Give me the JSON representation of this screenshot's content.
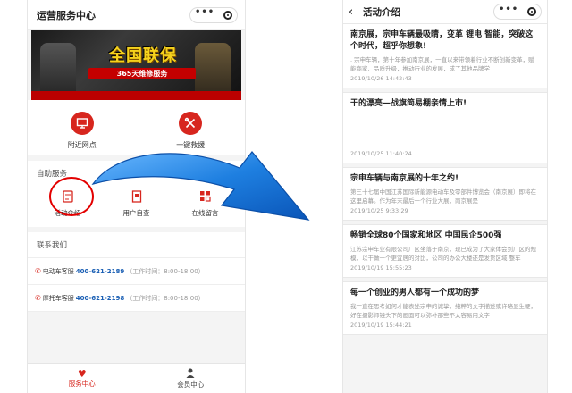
{
  "left_phone": {
    "title": "运营服务中心",
    "capsule": {
      "dots": "•••",
      "close_icon": "target-circle-icon"
    },
    "banner": {
      "main_text": "全国联保",
      "sub_text": "365天维修服务"
    },
    "quick_links": [
      {
        "label": "附近网点",
        "icon": "monitor-icon"
      },
      {
        "label": "一键救援",
        "icon": "tools-icon"
      }
    ],
    "self_service_title": "自助服务",
    "self_services": [
      {
        "label": "活动介绍",
        "icon": "document-icon"
      },
      {
        "label": "用户自查",
        "icon": "file-icon"
      },
      {
        "label": "在线留言",
        "icon": "grid-icon"
      }
    ],
    "contact_title": "联系我们",
    "contacts": [
      {
        "label": "电动车客服",
        "number": "400-621-2189",
        "hours": "（工作时间：8:00-18:00）"
      },
      {
        "label": "摩托车客服",
        "number": "400-621-2198",
        "hours": "（工作时间：8:00-18:00）"
      }
    ],
    "tabs": [
      {
        "label": "服务中心",
        "icon": "heart-icon",
        "active": true
      },
      {
        "label": "会员中心",
        "icon": "person-icon",
        "active": false
      }
    ]
  },
  "right_phone": {
    "title": "活动介绍",
    "back_icon": "chevron-left-icon",
    "articles": [
      {
        "title": "南京展，宗申车辆最吸睛，变革 锂电 智能，突破这个时代，超乎你想象!",
        "body": ". 宗申车辆，第十年参加南京展，一直以来带领着行业不断创新变革，赋能商家、品质升级，推动行业的发展，成了其他品牌学",
        "date": "2019/10/26 14:42:43"
      },
      {
        "title": "干的漂亮—战旗简易棚亲情上市!",
        "body": "",
        "date": "2019/10/25 11:40:24"
      },
      {
        "title": "宗申车辆与南京展的十年之约!",
        "body": "第三十七届中国江苏国际新能源电动车及零部件博览会（南京展）即将在这里启幕。作为年末最后一个行业大展，南京展是",
        "date": "2019/10/25 9:33:29"
      },
      {
        "title": "畅销全球80个国家和地区 中国民企500强",
        "body": "江苏宗申车业有限公司厂区坐落于南京，现已成为了大家体会到厂区的规模，以干做一个更宜居的对比，公司的办公大楼还是发货区域 整车",
        "date": "2019/10/19 15:55:23"
      },
      {
        "title": "每一个创业的男人都有一个成功的梦",
        "body": "我一直在思考如何才能表述宗申的诚挚，纯粹的文字描述或许略显生硬，好在摄影师镜头下的画面可以弥补那些不太容易用文字",
        "date": "2019/10/19 15:44:21"
      }
    ]
  },
  "colors": {
    "brand_red": "#d7261e",
    "arrow_blue": "#1e7fe0",
    "highlight_red": "#e30000",
    "link_blue": "#1a5fb4"
  }
}
